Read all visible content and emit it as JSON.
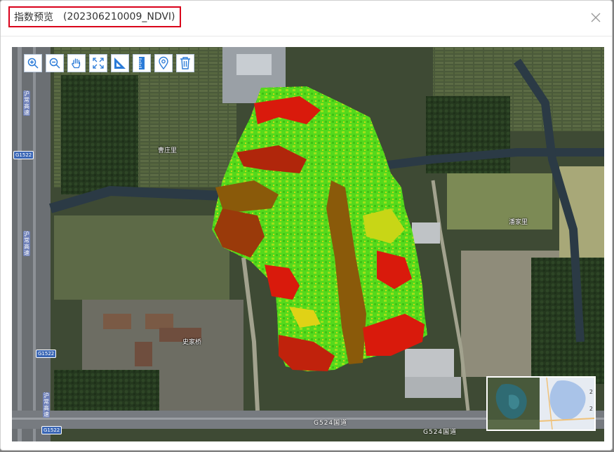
{
  "dialog": {
    "title_prefix": "指数预览",
    "title_id": "(202306210009_NDVI)"
  },
  "toolbar": {
    "tools": [
      {
        "name": "zoom-in",
        "icon": "zoom-in-icon"
      },
      {
        "name": "zoom-out",
        "icon": "zoom-out-icon"
      },
      {
        "name": "pan",
        "icon": "hand-icon"
      },
      {
        "name": "full-extent",
        "icon": "expand-icon"
      },
      {
        "name": "measure-area",
        "icon": "triangle-ruler-icon"
      },
      {
        "name": "measure-distance",
        "icon": "ruler-icon"
      },
      {
        "name": "place-marker",
        "icon": "location-pin-icon"
      },
      {
        "name": "clear",
        "icon": "trash-icon"
      }
    ]
  },
  "map": {
    "place_labels": {
      "north": "曹庄里",
      "east": "潘家里",
      "southwest": "史家桥"
    },
    "road_labels": {
      "highway_1": "G524国道",
      "highway_2": "G524国道"
    },
    "shields": {
      "top": "G1522",
      "middle": "G1522",
      "bottom": "G1522"
    },
    "vertical_labels": {
      "top": "沪常高速",
      "middle": "沪常高速",
      "bottom": "沪常高速"
    },
    "overlay_legend": {
      "high": "#3fd916",
      "mid": "#d9d916",
      "low": "#d91a0c",
      "bare": "#8a5a0a"
    }
  },
  "minimap": {
    "edge_numbers": [
      "2",
      "2"
    ]
  }
}
